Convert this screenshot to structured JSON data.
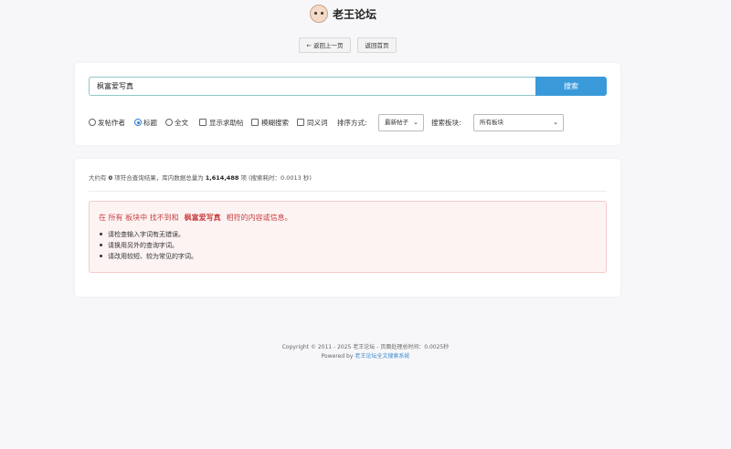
{
  "header": {
    "site_title": "老王论坛",
    "logo_icon": "pig-avatar-icon"
  },
  "nav": {
    "back": "← 返回上一页",
    "home": "返回首页"
  },
  "search": {
    "query": "枫富爱写真",
    "button": "搜索"
  },
  "options": {
    "radio_author": "发帖作者",
    "radio_title": "标题",
    "radio_fulltext": "全文",
    "selected_radio": "标题",
    "check_help": "显示求助帖",
    "check_fuzzy": "模糊搜索",
    "check_synonym": "同义词",
    "sort_label": "排序方式:",
    "sort_value": "最新帖子",
    "board_label": "搜索板块:",
    "board_value": "所有板块"
  },
  "results": {
    "stats_prefix": "大约有",
    "count": "0",
    "stats_mid": "项符合查询结果，库内数据总量为",
    "total": "1,614,488",
    "stats_suffix": "项 (搜索耗时：0.0013 秒)"
  },
  "alert": {
    "title_pre": "在 所有 板块中 找不到和",
    "keyword": "枫富爱写真",
    "title_post": "相符的内容或信息。",
    "tips": [
      "请检查输入字词有无错误。",
      "请换用另外的查询字词。",
      "请改用较短、较为常见的字词。"
    ]
  },
  "footer": {
    "copyright": "Copyright © 2011 - 2025 老王论坛 - 页面处理总时间：0.0025秒",
    "powered_prefix": "Powered by",
    "powered_link": "老王论坛全文搜索系统"
  },
  "colors": {
    "accent": "#3a9ad9",
    "alert_text": "#c94141",
    "alert_bg": "#fdf3f3"
  }
}
